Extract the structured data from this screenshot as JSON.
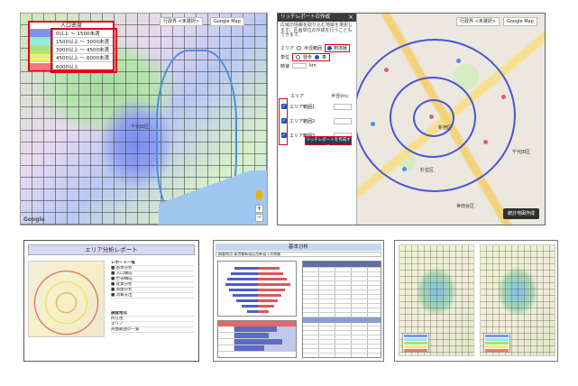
{
  "panel1": {
    "legend_title": "人口密度",
    "legend_items": [
      {
        "label": "0以上 ～ 1500未満",
        "color": "#7e93f2"
      },
      {
        "label": "1500以上 ～ 3000未満",
        "color": "#8feed8"
      },
      {
        "label": "3000以上 ～ 4500未満",
        "color": "#a7e27a"
      },
      {
        "label": "4500以上 ～ 6000未満",
        "color": "#eeee72"
      },
      {
        "label": "6000以上",
        "color": "#f07878"
      }
    ],
    "map_select_1": "行政界 <未選択>",
    "map_select_2": "Google Map",
    "place_label": "千代田区",
    "google": "Google"
  },
  "panel2": {
    "dialog_title": "リッチレポートの作成",
    "close_icon": "close-icon",
    "description": "広域の情報を取り込む地域を選択します。区画単位の作成を行うこともできます。",
    "area_label": "エリア",
    "area_options": [
      "半径範囲",
      "到達圏"
    ],
    "unit_label": "単位",
    "unit_options": [
      "徒歩",
      "車"
    ],
    "speed_label": "時速",
    "speed_unit": "km",
    "col_area": "エリア",
    "col_radius": "半径(m)",
    "rings": [
      "エリア範囲1",
      "エリア範囲2",
      "エリア範囲3"
    ],
    "create_button": "リッチレポートを作成する",
    "float_button": "統計地図作成",
    "map_select_1": "行政界 <未選択>",
    "map_select_2": "Google Map",
    "place_labels": [
      "新宿区",
      "杉並区",
      "千代田区",
      "世田谷区"
    ]
  },
  "panel3": {
    "title": "エリア分析レポート",
    "side_heading": "レポート一覧",
    "side_lines": [
      "■ 基本分析",
      "■ 人口構成",
      "■ 世帯構成",
      "■ 産業分析",
      "■ 商圏分析",
      "■ 消費支出"
    ],
    "sub_heading": "調査地点",
    "sub_lines": [
      "所在地",
      "エリア",
      "商圏範囲の一覧"
    ]
  },
  "panel4": {
    "title": "基本分析",
    "subtitle": "調査地点 東京都新宿区西新宿 1次商圏"
  },
  "colors": {
    "red_highlight": "#e0001a",
    "ring_blue": "#4a55d8",
    "dialog_header": "#3b3b3b"
  }
}
